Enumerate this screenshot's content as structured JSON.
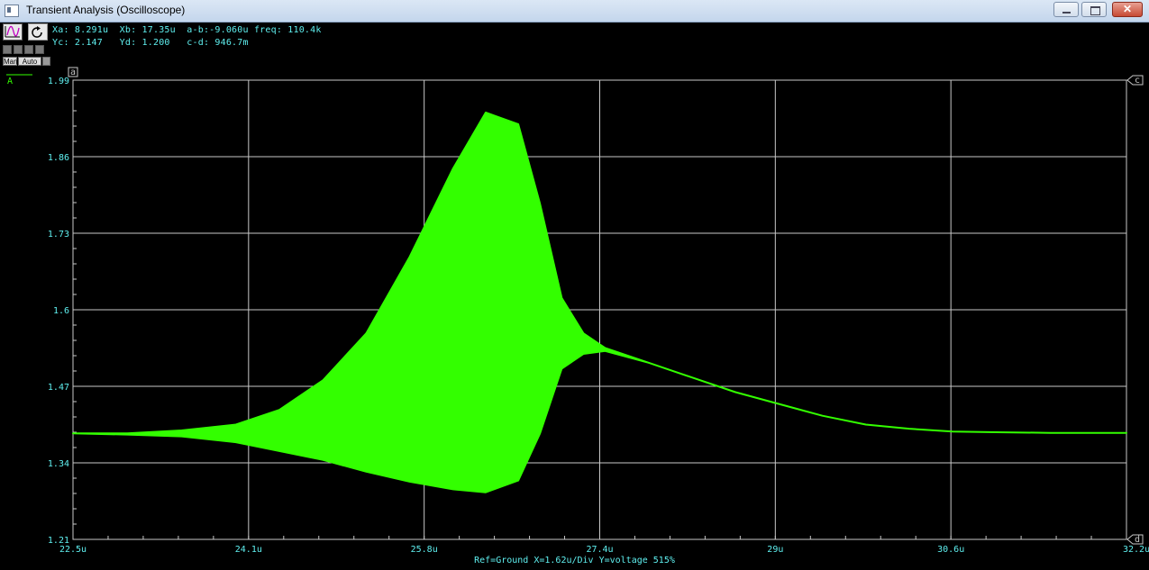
{
  "window": {
    "title": "Transient Analysis (Oscilloscope)",
    "close_glyph": "✕"
  },
  "toolbox": {
    "man_label": "Man",
    "auto_label": "Auto"
  },
  "readout": {
    "line1": "Xa: 8.291u  Xb: 17.35u  a-b:-9.060u freq: 110.4k",
    "line2": "Yc: 2.147   Yd: 1.200   c-d: 946.7m"
  },
  "markers": {
    "a": "a",
    "c": "c",
    "d": "d",
    "trace_label": "A"
  },
  "status": {
    "text": "Ref=Ground  X=1.62u/Div Y=voltage 515%"
  },
  "colors": {
    "trace": "#33ff00",
    "grid": "#c8c8c8",
    "labels": "#5ff0f0"
  },
  "chart_data": {
    "type": "area",
    "x_ticks": [
      "22.5u",
      "24.1u",
      "25.8u",
      "27.4u",
      "29u",
      "30.6u",
      "32.2u"
    ],
    "y_ticks": [
      "1.99",
      "1.86",
      "1.73",
      "1.6",
      "1.47",
      "1.34",
      "1.21"
    ],
    "xlim": [
      22.5,
      32.2
    ],
    "ylim": [
      1.21,
      1.99
    ],
    "upper_envelope": {
      "x": [
        22.5,
        23.0,
        23.5,
        24.0,
        24.4,
        24.8,
        25.2,
        25.6,
        26.0,
        26.3,
        26.6,
        26.8,
        27.0,
        27.2,
        27.4,
        27.8,
        28.2,
        28.6,
        29.0,
        29.4,
        29.8,
        30.2,
        30.6,
        31.0,
        31.5,
        32.2
      ],
      "y": [
        1.39,
        1.39,
        1.395,
        1.405,
        1.43,
        1.48,
        1.56,
        1.69,
        1.84,
        1.935,
        1.915,
        1.78,
        1.62,
        1.56,
        1.535,
        1.51,
        1.485,
        1.46,
        1.44,
        1.42,
        1.405,
        1.398,
        1.393,
        1.392,
        1.391,
        1.391
      ]
    },
    "lower_envelope": {
      "x": [
        22.5,
        23.0,
        23.5,
        24.0,
        24.4,
        24.8,
        25.2,
        25.6,
        26.0,
        26.3,
        26.6,
        26.8,
        27.0,
        27.2,
        27.4,
        27.8,
        28.2,
        28.6,
        29.0,
        29.4,
        29.8,
        30.2,
        30.6,
        31.0,
        31.5,
        32.2
      ],
      "y": [
        1.39,
        1.388,
        1.385,
        1.375,
        1.36,
        1.345,
        1.325,
        1.308,
        1.295,
        1.29,
        1.31,
        1.39,
        1.5,
        1.525,
        1.53,
        1.51,
        1.485,
        1.46,
        1.44,
        1.42,
        1.405,
        1.398,
        1.393,
        1.392,
        1.391,
        1.391
      ]
    },
    "grid": true
  }
}
